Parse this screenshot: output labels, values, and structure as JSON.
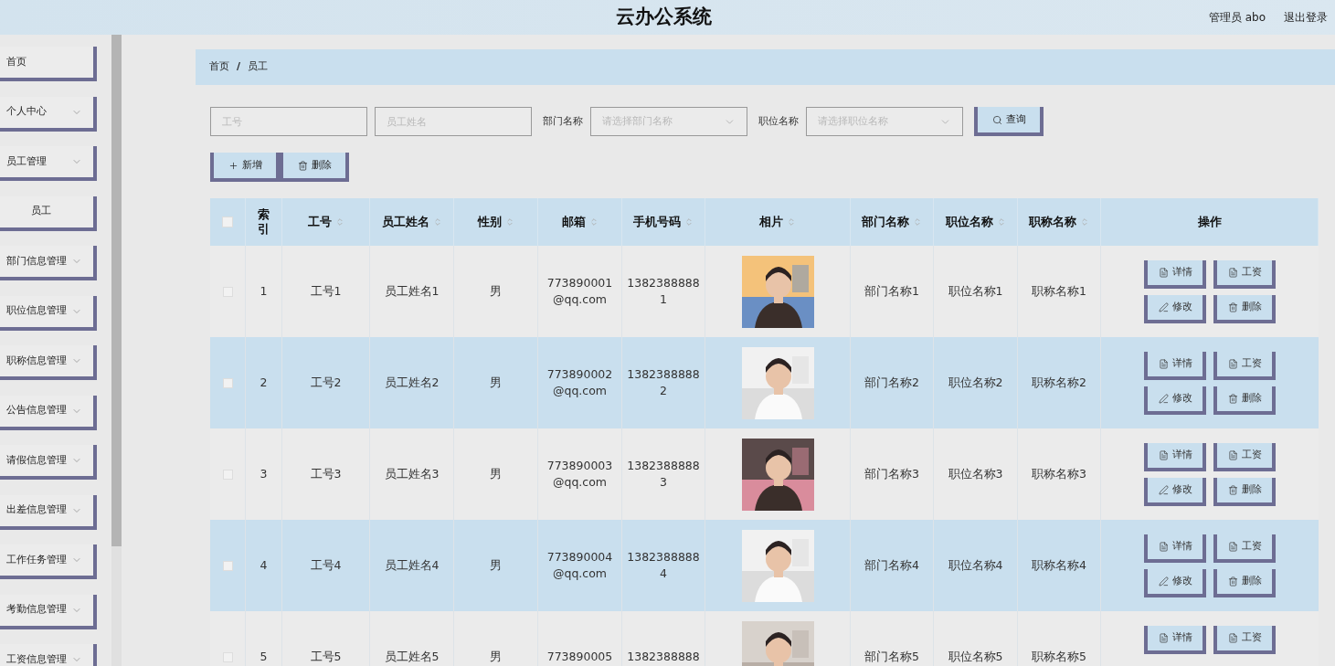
{
  "header": {
    "title": "云办公系统",
    "user": "管理员 abo",
    "logout": "退出登录"
  },
  "sidebar": {
    "items": [
      {
        "label": "首页",
        "kind": "link"
      },
      {
        "label": "个人中心",
        "kind": "group"
      },
      {
        "label": "员工管理",
        "kind": "group"
      },
      {
        "label": "员工",
        "kind": "sub"
      },
      {
        "label": "部门信息管理",
        "kind": "group"
      },
      {
        "label": "职位信息管理",
        "kind": "group"
      },
      {
        "label": "职称信息管理",
        "kind": "group"
      },
      {
        "label": "公告信息管理",
        "kind": "group"
      },
      {
        "label": "请假信息管理",
        "kind": "group"
      },
      {
        "label": "出差信息管理",
        "kind": "group"
      },
      {
        "label": "工作任务管理",
        "kind": "group"
      },
      {
        "label": "考勤信息管理",
        "kind": "group"
      },
      {
        "label": "工资信息管理",
        "kind": "group"
      }
    ]
  },
  "breadcrumb": [
    "首页",
    "/",
    "员工"
  ],
  "search": {
    "fields": [
      {
        "kind": "input",
        "placeholder": "工号"
      },
      {
        "kind": "input",
        "placeholder": "员工姓名"
      },
      {
        "kind": "select",
        "label": "部门名称",
        "placeholder": "请选择部门名称"
      },
      {
        "kind": "select",
        "label": "职位名称",
        "placeholder": "请选择职位名称"
      }
    ],
    "button": "查询"
  },
  "actions": [
    {
      "kind": "add",
      "label": "新增"
    },
    {
      "kind": "delete",
      "label": "删除"
    }
  ],
  "table": {
    "header_checked": false,
    "columns": [
      {
        "label": "索引",
        "sortable": false
      },
      {
        "label": "工号",
        "sortable": true
      },
      {
        "label": "员工姓名",
        "sortable": true
      },
      {
        "label": "性别",
        "sortable": true
      },
      {
        "label": "邮箱",
        "sortable": true
      },
      {
        "label": "手机号码",
        "sortable": true
      },
      {
        "label": "相片",
        "sortable": true
      },
      {
        "label": "部门名称",
        "sortable": true
      },
      {
        "label": "职位名称",
        "sortable": true
      },
      {
        "label": "职称名称",
        "sortable": true
      },
      {
        "label": "操作",
        "sortable": false
      }
    ],
    "rows": [
      {
        "checked": false,
        "index": "1",
        "id": "工号1",
        "name": "员工姓名1",
        "gender": "男",
        "email": [
          "773890001",
          "@qq.com"
        ],
        "phone": [
          "1382388888",
          "1"
        ],
        "photo": {
          "kind": "picture"
        },
        "dept": "部门名称1",
        "position": "职位名称1",
        "title": "职称名称1",
        "buttons": [
          {
            "kind": "detail",
            "label": "详情"
          },
          {
            "kind": "salary",
            "label": "工资"
          },
          {
            "kind": "edit",
            "label": "修改"
          },
          {
            "kind": "delete",
            "label": "删除"
          }
        ]
      },
      {
        "checked": false,
        "index": "2",
        "id": "工号2",
        "name": "员工姓名2",
        "gender": "男",
        "email": [
          "773890002",
          "@qq.com"
        ],
        "phone": [
          "1382388888",
          "2"
        ],
        "photo": {
          "kind": "picture"
        },
        "dept": "部门名称2",
        "position": "职位名称2",
        "title": "职称名称2",
        "buttons": [
          {
            "kind": "detail",
            "label": "详情"
          },
          {
            "kind": "salary",
            "label": "工资"
          },
          {
            "kind": "edit",
            "label": "修改"
          },
          {
            "kind": "delete",
            "label": "删除"
          }
        ]
      },
      {
        "checked": false,
        "index": "3",
        "id": "工号3",
        "name": "员工姓名3",
        "gender": "男",
        "email": [
          "773890003",
          "@qq.com"
        ],
        "phone": [
          "1382388888",
          "3"
        ],
        "photo": {
          "kind": "picture"
        },
        "dept": "部门名称3",
        "position": "职位名称3",
        "title": "职称名称3",
        "buttons": [
          {
            "kind": "detail",
            "label": "详情"
          },
          {
            "kind": "salary",
            "label": "工资"
          },
          {
            "kind": "edit",
            "label": "修改"
          },
          {
            "kind": "delete",
            "label": "删除"
          }
        ]
      },
      {
        "checked": false,
        "index": "4",
        "id": "工号4",
        "name": "员工姓名4",
        "gender": "男",
        "email": [
          "773890004",
          "@qq.com"
        ],
        "phone": [
          "1382388888",
          "4"
        ],
        "photo": {
          "kind": "picture"
        },
        "dept": "部门名称4",
        "position": "职位名称4",
        "title": "职称名称4",
        "buttons": [
          {
            "kind": "detail",
            "label": "详情"
          },
          {
            "kind": "salary",
            "label": "工资"
          },
          {
            "kind": "edit",
            "label": "修改"
          },
          {
            "kind": "delete",
            "label": "删除"
          }
        ]
      },
      {
        "checked": false,
        "index": "5",
        "id": "工号5",
        "name": "员工姓名5",
        "gender": "男",
        "email": [
          "773890005"
        ],
        "phone": [
          "1382388888"
        ],
        "photo": {
          "kind": "picture"
        },
        "dept": "部门名称5",
        "position": "职位名称5",
        "title": "职称名称5",
        "buttons": [
          {
            "kind": "detail",
            "label": "详情"
          },
          {
            "kind": "salary",
            "label": "工资"
          }
        ]
      }
    ]
  }
}
